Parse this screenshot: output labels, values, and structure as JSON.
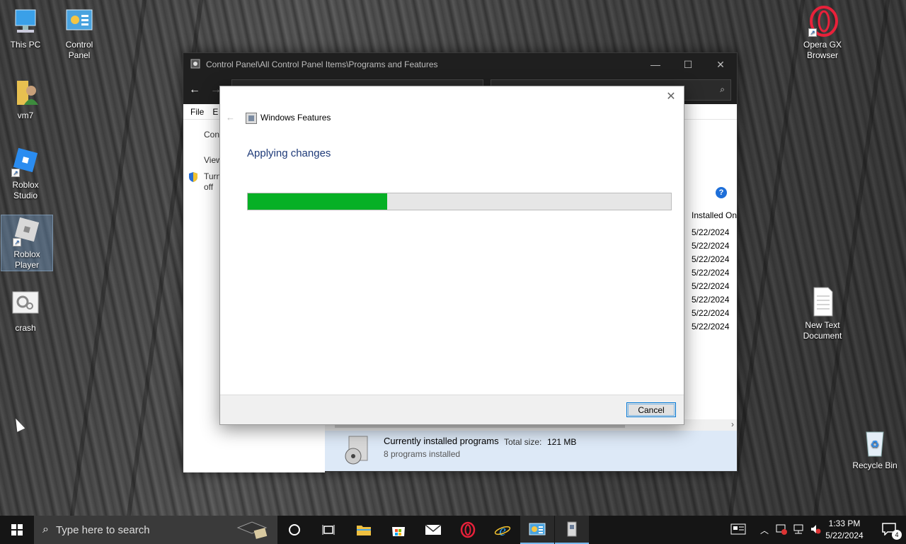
{
  "desktop": {
    "icons": [
      {
        "label": "This PC",
        "icon": "this-pc-icon"
      },
      {
        "label": "Control Panel",
        "icon": "control-panel-icon"
      },
      {
        "label": "vm7",
        "icon": "user-folder-icon"
      },
      {
        "label": "Roblox Studio",
        "icon": "roblox-studio-icon"
      },
      {
        "label": "Roblox Player",
        "icon": "roblox-player-icon"
      },
      {
        "label": "crash",
        "icon": "settings-file-icon"
      },
      {
        "label": "Opera GX Browser",
        "icon": "opera-gx-icon"
      },
      {
        "label": "New Text Document",
        "icon": "text-document-icon"
      },
      {
        "label": "Recycle Bin",
        "icon": "recycle-bin-icon"
      }
    ]
  },
  "window": {
    "title": "Control Panel\\All Control Panel Items\\Programs and Features",
    "menu": {
      "file": "File",
      "edit": "E"
    },
    "left_pane": {
      "home": "Contr",
      "view": "View",
      "turn1": "Turn",
      "turn2": "off"
    },
    "column_installed_on": "Installed On",
    "dates": [
      "5/22/2024",
      "5/22/2024",
      "5/22/2024",
      "5/22/2024",
      "5/22/2024",
      "5/22/2024",
      "5/22/2024",
      "5/22/2024"
    ],
    "details": {
      "title": "Currently installed programs",
      "size_label": "Total size:",
      "size_value": "121 MB",
      "count": "8 programs installed"
    }
  },
  "dialog": {
    "title": "Windows Features",
    "heading": "Applying changes",
    "progress": 0.33,
    "cancel_label": "Cancel"
  },
  "taskbar": {
    "search_placeholder": "Type here to search",
    "time": "1:33 PM",
    "date": "5/22/2024",
    "notification_count": "4"
  }
}
